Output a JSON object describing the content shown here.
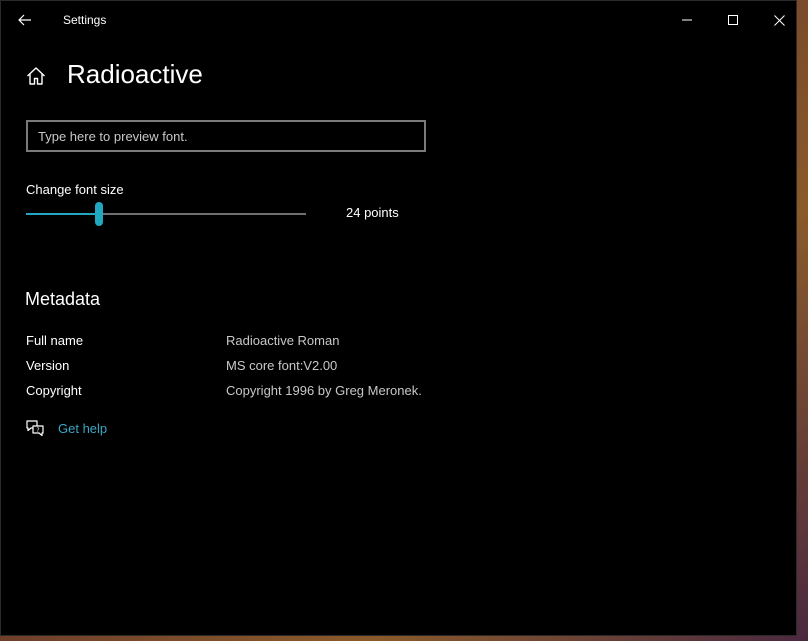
{
  "window": {
    "title": "Settings",
    "icons": {
      "back": "back-arrow-icon",
      "minimize": "minimize-icon",
      "maximize": "maximize-icon",
      "close": "close-icon",
      "home": "home-icon",
      "help": "chat-help-icon"
    }
  },
  "page": {
    "title": "Radioactive"
  },
  "preview": {
    "placeholder": "Type here to preview font.",
    "value": ""
  },
  "font_size": {
    "label": "Change font size",
    "value_text": "24 points",
    "slider_fraction": 0.26,
    "accent_color": "#23a6c0"
  },
  "metadata": {
    "title": "Metadata",
    "rows": [
      {
        "key": "Full name",
        "value": "Radioactive Roman"
      },
      {
        "key": "Version",
        "value": "MS core font:V2.00"
      },
      {
        "key": "Copyright",
        "value": "Copyright 1996 by Greg Meronek."
      }
    ]
  },
  "help": {
    "label": "Get help",
    "link_color": "#3aa6c4"
  }
}
